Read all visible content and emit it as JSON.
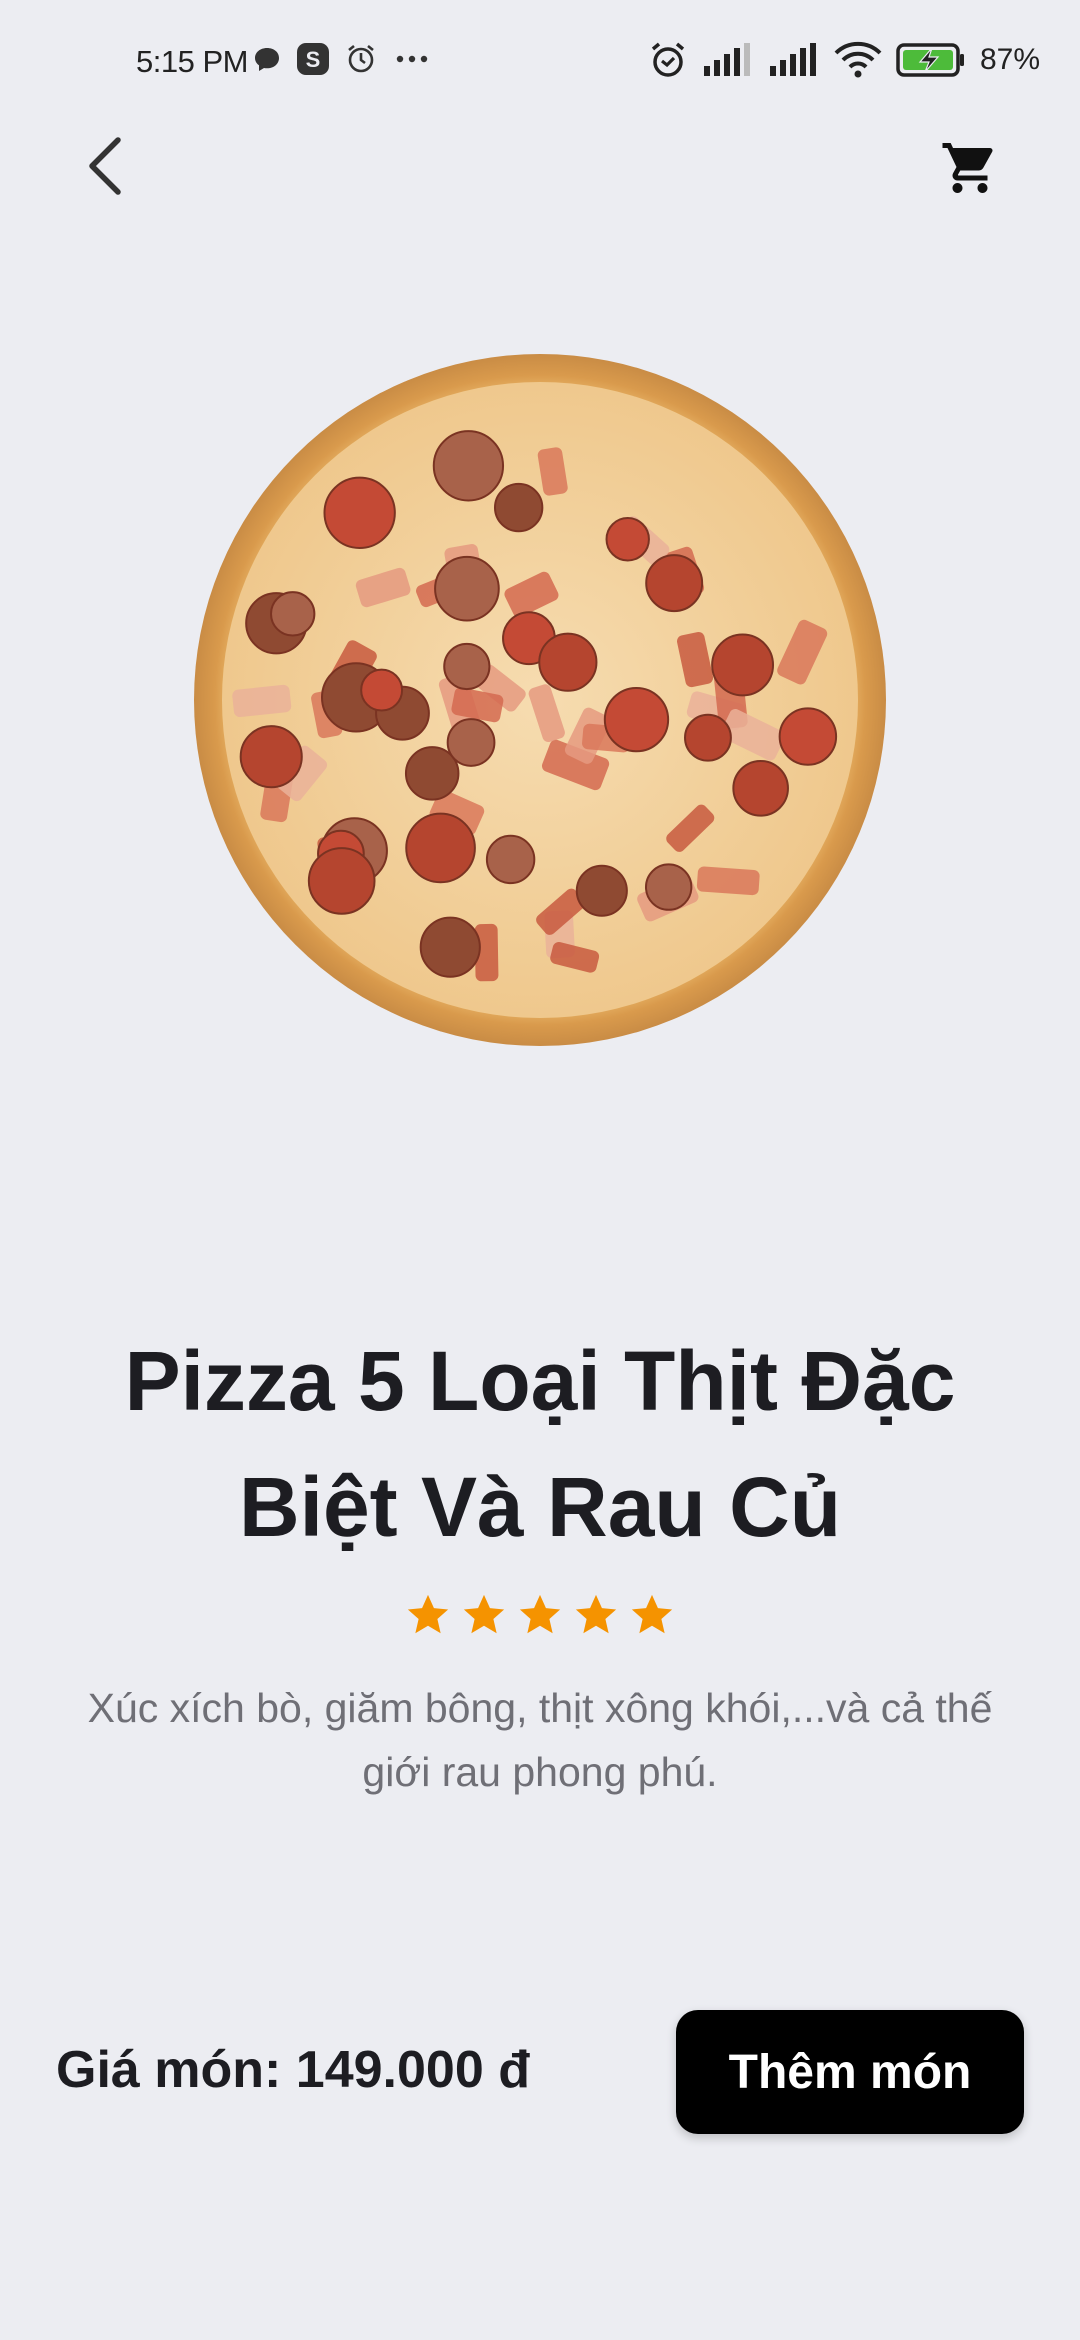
{
  "status_bar": {
    "time": "5:15 PM",
    "battery": "87%",
    "icons": [
      "chat-bubble-icon",
      "s-app-icon",
      "alarm-icon",
      "more-dots-icon",
      "alarm-clock-icon",
      "signal-icon",
      "signal-icon",
      "wifi-icon",
      "battery-charging-icon"
    ]
  },
  "nav": {
    "back_icon": "chevron-left-icon",
    "cart_icon": "shopping-cart-icon"
  },
  "product": {
    "name": "Pizza 5 Loại Thịt Đặc Biệt Và Rau Củ",
    "rating": 5,
    "rating_max": 5,
    "description": "Xúc xích bò, giăm bông, thịt xông khói,...và cả thế giới rau phong phú.",
    "price_label": "Giá món: ",
    "price_value": "149.000 đ"
  },
  "actions": {
    "add_label": "Thêm món"
  },
  "colors": {
    "background": "#ecedf2",
    "star": "#f59300",
    "button": "#000000"
  }
}
